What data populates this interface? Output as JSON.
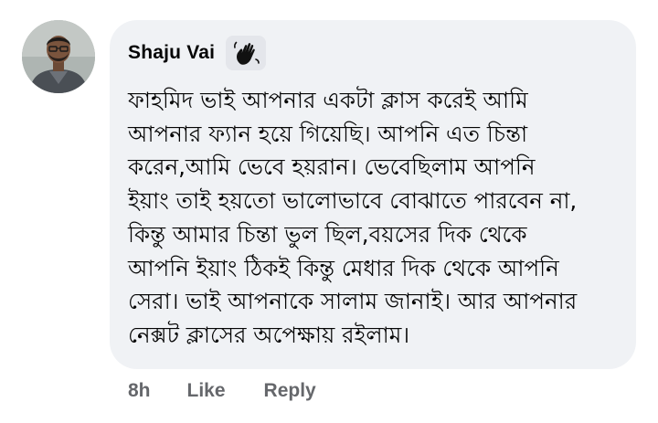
{
  "comment": {
    "author": "Shaju Vai",
    "badge_icon": "wave-hand-icon",
    "text_lines": [
      "ফাহমিদ ভাই আপনার একটা ক্লাস করেই আমি",
      "আপনার ফ্যান হয়ে গিয়েছি। আপনি এত চিন্তা",
      "করেন,আমি ভেবে হয়রান। ভেবেছিলাম আপনি",
      "ইয়াং তাই হয়তো ভালোভাবে বোঝাতে পারবেন না,",
      "কিন্তু আমার চিন্তা ভুল ছিল,বয়সের দিক থেকে",
      "আপনি ইয়াং ঠিকই কিন্তু মেধার দিক থেকে আপনি",
      "সেরা। ভাই আপনাকে সালাম জানাই। আর আপনার",
      "নেক্সট ক্লাসের অপেক্ষায় রইলাম।"
    ],
    "time": "8h",
    "like_label": "Like",
    "reply_label": "Reply"
  },
  "colors": {
    "bubble_bg": "#f0f2f5",
    "text": "#050505",
    "secondary_text": "#65676b",
    "badge_bg": "#e4e6eb"
  }
}
